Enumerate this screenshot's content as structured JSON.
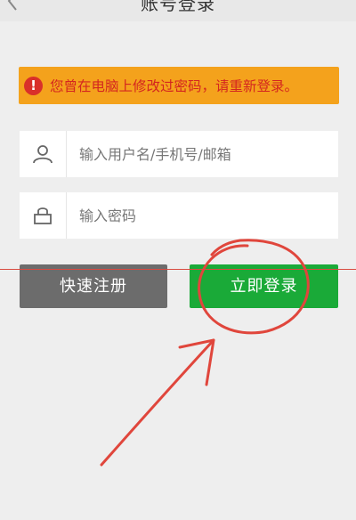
{
  "header": {
    "title": "账号登录"
  },
  "alert": {
    "text": "您曾在电脑上修改过密码，请重新登录。",
    "icon": "!",
    "color": "#f4a21c"
  },
  "form": {
    "username_placeholder": "输入用户名/手机号/邮箱",
    "password_placeholder": "输入密码"
  },
  "buttons": {
    "register_label": "快速注册",
    "login_label": "立即登录",
    "register_color": "#6c6c6c",
    "login_color": "#1aaa38"
  },
  "annotation": {
    "color": "#d94a40"
  }
}
